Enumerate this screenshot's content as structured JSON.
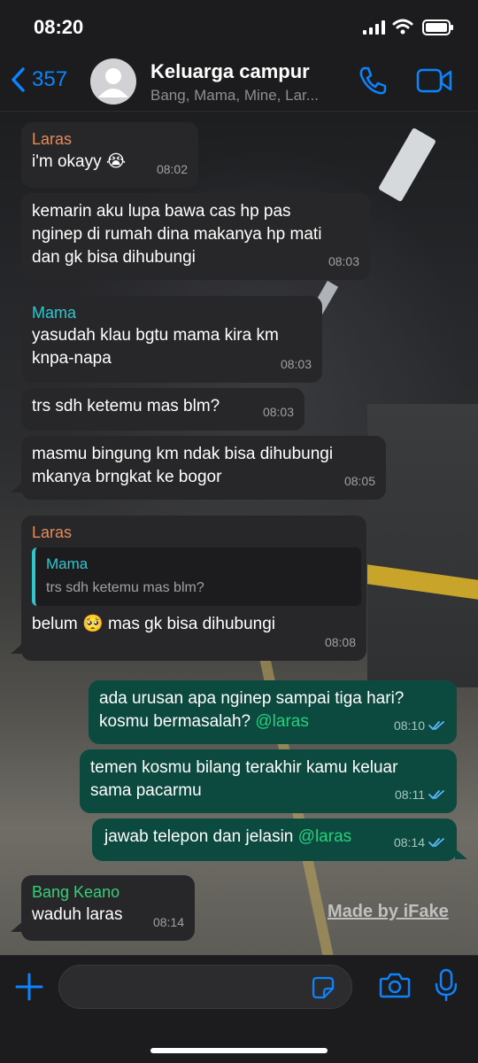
{
  "status_bar": {
    "time": "08:20"
  },
  "header": {
    "back_count": "357",
    "title": "Keluarga campur",
    "subtitle": "Bang, Mama, Mine, Lar..."
  },
  "colors": {
    "accent": "#0a84ff",
    "outgoing_bubble": "#0c4a3f",
    "incoming_bubble": "#272729",
    "laras": "#e98a5a",
    "mama": "#2fc6d0",
    "bang_keano": "#33d17a",
    "mention": "#26d07c"
  },
  "messages": [
    {
      "sender": "Laras",
      "text": "i'm okayy 😭",
      "time": "08:02"
    },
    {
      "text": "kemarin aku lupa bawa cas hp pas nginep di rumah dina makanya hp mati dan gk bisa dihubungi",
      "time": "08:03"
    },
    {
      "sender": "Mama",
      "text": "yasudah klau bgtu mama kira km knpa-napa",
      "time": "08:03"
    },
    {
      "text": "trs sdh ketemu mas blm?",
      "time": "08:03"
    },
    {
      "text": "masmu bingung km ndak bisa dihubungi mkanya brngkat ke bogor",
      "time": "08:05"
    },
    {
      "sender": "Laras",
      "quote_name": "Mama",
      "quote_text": "trs sdh ketemu mas blm?",
      "text": "belum 🥺 mas gk bisa dihubungi",
      "time": "08:08"
    },
    {
      "text": "ada urusan apa nginep sampai tiga hari? kosmu bermasalah?",
      "mention": "@laras",
      "time": "08:10"
    },
    {
      "text": "temen kosmu bilang terakhir kamu keluar sama pacarmu",
      "time": "08:11"
    },
    {
      "text": "jawab telepon dan jelasin",
      "mention": "@laras",
      "time": "08:14"
    },
    {
      "sender": "Bang Keano",
      "text": "waduh laras",
      "time": "08:14"
    }
  ],
  "watermark": "Made by iFake",
  "input": {
    "placeholder": ""
  },
  "icons": [
    "back-chevron-icon",
    "call-icon",
    "video-icon",
    "plus-icon",
    "sticker-icon",
    "camera-icon",
    "mic-icon",
    "read-check-icon",
    "signal-icon",
    "wifi-icon",
    "battery-icon"
  ]
}
